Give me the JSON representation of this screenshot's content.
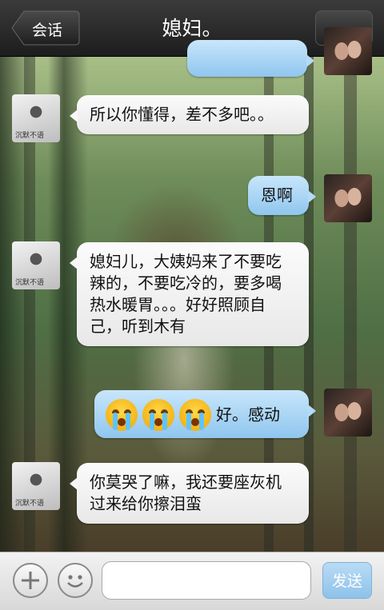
{
  "header": {
    "back_label": "会话",
    "title": "媳妇。"
  },
  "avatars": {
    "her_signature": "沉默不语"
  },
  "messages": [
    {
      "sender": "her",
      "text": "所以你懂得，差不多吧。。"
    },
    {
      "sender": "me",
      "text": "恩啊"
    },
    {
      "sender": "her",
      "text": "媳妇儿，大姨妈来了不要吃辣的，不要吃冷的，要多喝热水暖胃。。。好好照顾自己，听到木有"
    },
    {
      "sender": "me",
      "emoji": [
        "crying-emoji",
        "crying-emoji",
        "crying-emoji"
      ],
      "text": "好。感动"
    },
    {
      "sender": "her",
      "text": "你莫哭了嘛，我还要座灰机过来给你擦泪蛮"
    }
  ],
  "composer": {
    "input_value": "",
    "send_label": "发送"
  },
  "icons": [
    "back-arrow-icon",
    "more-dots-icon",
    "plus-icon",
    "smiley-icon",
    "crying-emoji"
  ],
  "colors": {
    "bar_dark": "#1d1d1d",
    "bubble_blue": "#9ccbee",
    "bubble_white": "#f4f4f4",
    "send_blue": "#8ec2ea"
  }
}
